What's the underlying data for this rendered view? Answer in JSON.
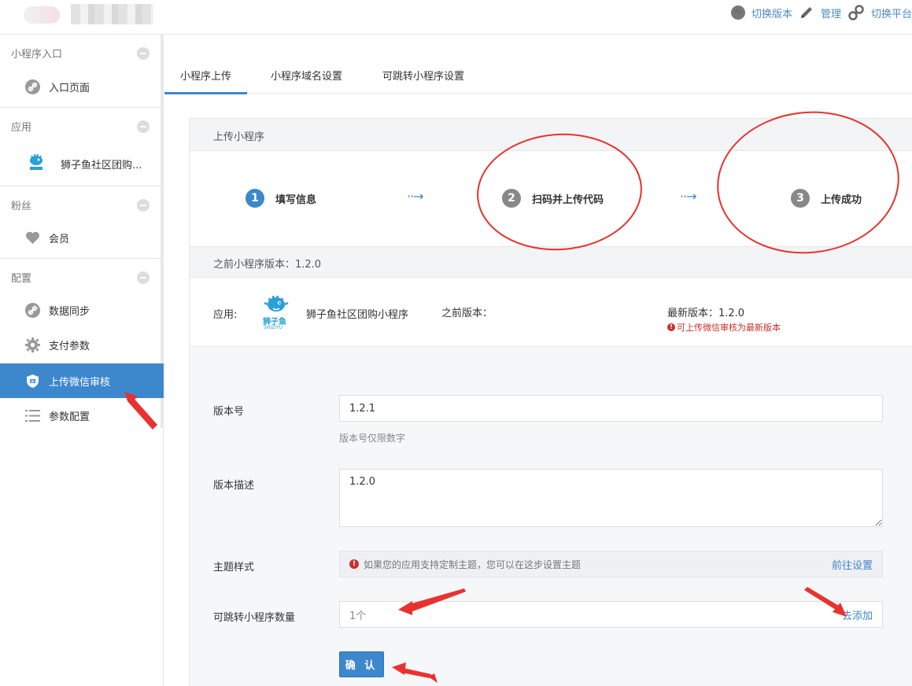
{
  "topbar": {
    "nav": [
      {
        "icon": "swap-circle-icon",
        "label": "切换版本"
      },
      {
        "icon": "pencil-icon",
        "label": "管理"
      },
      {
        "icon": "link-icon",
        "label": "切换平台"
      }
    ]
  },
  "sidebar": {
    "sections": [
      {
        "title": "小程序入口",
        "items": [
          {
            "icon": "link-icon",
            "label": "入口页面"
          }
        ]
      },
      {
        "title": "应用",
        "items": [
          {
            "icon": "shizi-fish-logo",
            "label": "狮子鱼社区团购..."
          }
        ]
      },
      {
        "title": "粉丝",
        "items": [
          {
            "icon": "heart-icon",
            "label": "会员"
          }
        ]
      },
      {
        "title": "配置",
        "items": [
          {
            "icon": "link-icon",
            "label": "数据同步"
          },
          {
            "icon": "gear-icon",
            "label": "支付参数"
          },
          {
            "icon": "shield-icon",
            "label": "上传微信审核",
            "active": true
          },
          {
            "icon": "list-icon",
            "label": "参数配置"
          }
        ]
      }
    ]
  },
  "tabs": [
    "小程序上传",
    "小程序域名设置",
    "可跳转小程序设置"
  ],
  "panel": {
    "title": "上传小程序",
    "steps": [
      {
        "num": "1",
        "label": "填写信息",
        "status": "current"
      },
      {
        "num": "2",
        "label": "扫码并上传代码",
        "status": "pending"
      },
      {
        "num": "3",
        "label": "上传成功",
        "status": "pending"
      }
    ],
    "step_arrow": "··→",
    "prev_version_bar": "之前小程序版本：1.2.0",
    "app_row": {
      "label": "应用:",
      "logo_text": "狮子鱼",
      "logo_subtext": "SHIZIYU",
      "app_name": "狮子鱼社区团购小程序",
      "prev_version_label": "之前版本：",
      "latest_version": "最新版本：1.2.0",
      "tip": "可上传微信审核为最新版本"
    },
    "form": {
      "version_label": "版本号",
      "version_value": "1.2.1",
      "version_help": "版本号仅限数字",
      "desc_label": "版本描述",
      "desc_value": "1.2.0",
      "theme_label": "主题样式",
      "theme_tip": "如果您的应用支持定制主题，您可以在这步设置主题",
      "theme_link": "前往设置",
      "jump_label": "可跳转小程序数量",
      "jump_value": "1个",
      "jump_link": "去添加",
      "confirm_label": "确 认"
    }
  },
  "colors": {
    "accent": "#3d87cd",
    "annotation_red": "#e8322f",
    "error": "#c9302c"
  }
}
